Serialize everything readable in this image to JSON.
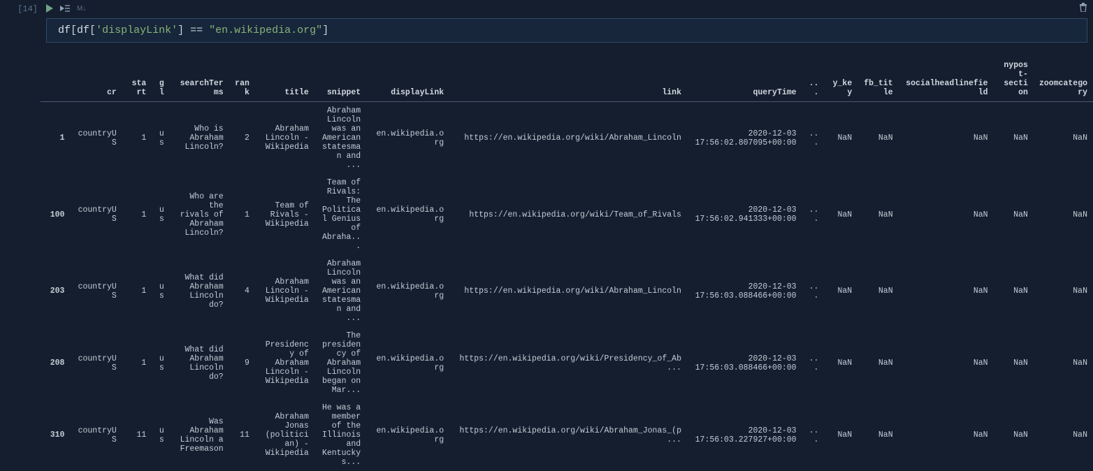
{
  "cell": {
    "exec_count": "[14]",
    "toolbar_md": "M↓"
  },
  "code": {
    "line_html": "<span class='tok-var'>df</span><span class='tok-op'>[</span><span class='tok-var'>df</span><span class='tok-op'>[</span><span class='tok-str'>'displayLink'</span><span class='tok-op'>]</span> <span class='tok-op'>==</span> <span class='tok-str'>\"en.wikipedia.org\"</span><span class='tok-op'>]</span>"
  },
  "table": {
    "columns": [
      "",
      "cr",
      "start",
      "gl",
      "searchTerms",
      "rank",
      "title",
      "snippet",
      "displayLink",
      "link",
      "queryTime",
      "...",
      "y_key",
      "fb_title",
      "socialheadlinefield",
      "nypost-section",
      "zoomcategory"
    ],
    "rows": [
      {
        "idx": "1",
        "cr": "countryUS",
        "start": "1",
        "gl": "us",
        "searchTerms": "Who is Abraham Lincoln?",
        "rank": "2",
        "title": "Abraham Lincoln - Wikipedia",
        "snippet": "Abraham Lincoln was an American statesman and ...",
        "displayLink": "en.wikipedia.org",
        "link": "https://en.wikipedia.org/wiki/Abraham_Lincoln",
        "queryTime": "2020-12-03 17:56:02.807095+00:00",
        "ellipsis": "...",
        "y_key": "NaN",
        "fb_title": "NaN",
        "socialheadlinefield": "NaN",
        "nypost": "NaN",
        "zoom": "NaN"
      },
      {
        "idx": "100",
        "cr": "countryUS",
        "start": "1",
        "gl": "us",
        "searchTerms": "Who are the rivals of Abraham Lincoln?",
        "rank": "1",
        "title": "Team of Rivals - Wikipedia",
        "snippet": "Team of Rivals: The Political Genius of Abraha...",
        "displayLink": "en.wikipedia.org",
        "link": "https://en.wikipedia.org/wiki/Team_of_Rivals",
        "queryTime": "2020-12-03 17:56:02.941333+00:00",
        "ellipsis": "...",
        "y_key": "NaN",
        "fb_title": "NaN",
        "socialheadlinefield": "NaN",
        "nypost": "NaN",
        "zoom": "NaN"
      },
      {
        "idx": "203",
        "cr": "countryUS",
        "start": "1",
        "gl": "us",
        "searchTerms": "What did Abraham Lincoln do?",
        "rank": "4",
        "title": "Abraham Lincoln - Wikipedia",
        "snippet": "Abraham Lincoln was an American statesman and ...",
        "displayLink": "en.wikipedia.org",
        "link": "https://en.wikipedia.org/wiki/Abraham_Lincoln",
        "queryTime": "2020-12-03 17:56:03.088466+00:00",
        "ellipsis": "...",
        "y_key": "NaN",
        "fb_title": "NaN",
        "socialheadlinefield": "NaN",
        "nypost": "NaN",
        "zoom": "NaN"
      },
      {
        "idx": "208",
        "cr": "countryUS",
        "start": "1",
        "gl": "us",
        "searchTerms": "What did Abraham Lincoln do?",
        "rank": "9",
        "title": "Presidency of Abraham Lincoln - Wikipedia",
        "snippet": "The presidency of Abraham Lincoln began on Mar...",
        "displayLink": "en.wikipedia.org",
        "link": "https://en.wikipedia.org/wiki/Presidency_of_Ab...",
        "queryTime": "2020-12-03 17:56:03.088466+00:00",
        "ellipsis": "...",
        "y_key": "NaN",
        "fb_title": "NaN",
        "socialheadlinefield": "NaN",
        "nypost": "NaN",
        "zoom": "NaN"
      },
      {
        "idx": "310",
        "cr": "countryUS",
        "start": "11",
        "gl": "us",
        "searchTerms": "Was Abraham Lincoln a Freemason",
        "rank": "11",
        "title": "Abraham Jonas (politician) - Wikipedia",
        "snippet": "He was a member of the Illinois and Kentucky s...",
        "displayLink": "en.wikipedia.org",
        "link": "https://en.wikipedia.org/wiki/Abraham_Jonas_(p...",
        "queryTime": "2020-12-03 17:56:03.227927+00:00",
        "ellipsis": "...",
        "y_key": "NaN",
        "fb_title": "NaN",
        "socialheadlinefield": "NaN",
        "nypost": "NaN",
        "zoom": "NaN"
      }
    ]
  }
}
